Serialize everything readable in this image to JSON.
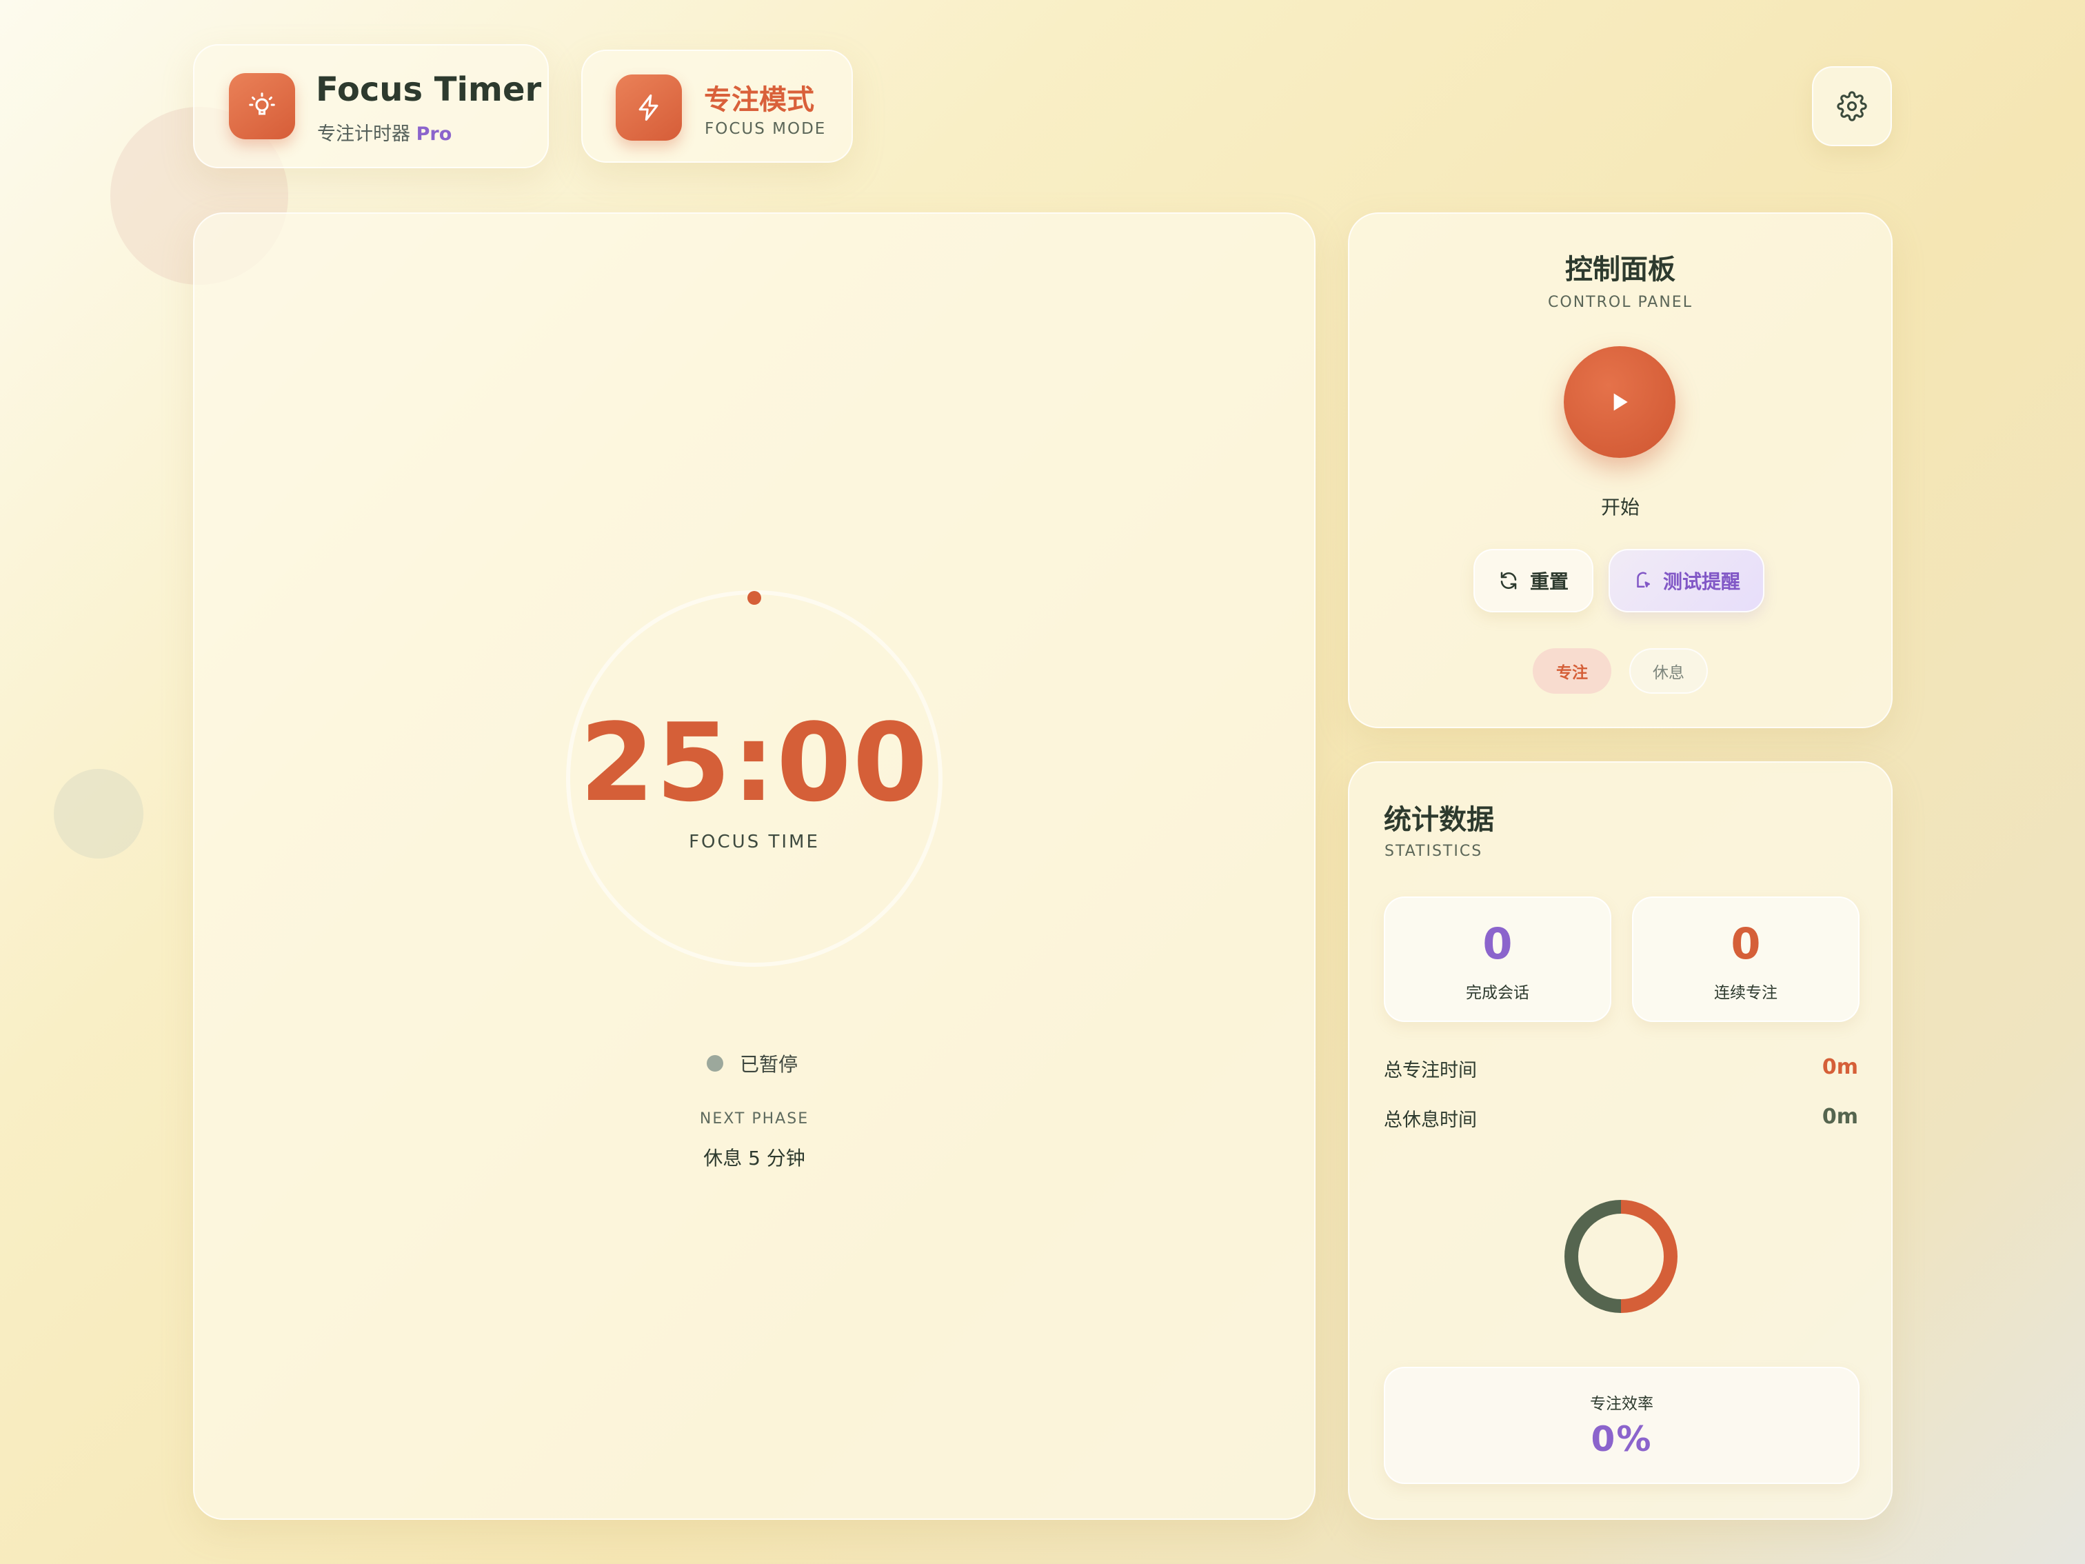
{
  "header": {
    "app_title": "Focus Timer",
    "app_subtitle": "专注计时器",
    "app_badge": "Pro",
    "app_icon": "lightbulb-icon",
    "mode_title": "专注模式",
    "mode_subtitle": "FOCUS MODE",
    "mode_icon": "lightning-icon",
    "settings_icon": "gear-icon"
  },
  "timer": {
    "time": "25:00",
    "label": "FOCUS TIME",
    "progress": 0,
    "status": "已暂停",
    "next_label": "NEXT PHASE",
    "next_value": "休息 5 分钟"
  },
  "control": {
    "title": "控制面板",
    "subtitle": "CONTROL PANEL",
    "play_icon": "play-icon",
    "play_label": "开始",
    "reset_label": "重置",
    "reset_icon": "refresh-icon",
    "test_label": "测试提醒",
    "test_icon": "bell-icon",
    "chip_focus": "专注",
    "chip_rest": "休息"
  },
  "stats": {
    "title": "统计数据",
    "subtitle": "STATISTICS",
    "completed_value": "0",
    "completed_label": "完成会话",
    "streak_value": "0",
    "streak_label": "连续专注",
    "total_focus_label": "总专注时间",
    "total_focus_value": "0m",
    "total_rest_label": "总休息时间",
    "total_rest_value": "0m",
    "efficiency_label": "专注效率",
    "efficiency_value": "0%"
  },
  "colors": {
    "accent": "#d55f38",
    "purple": "#8b64cc",
    "green": "#55654f"
  }
}
